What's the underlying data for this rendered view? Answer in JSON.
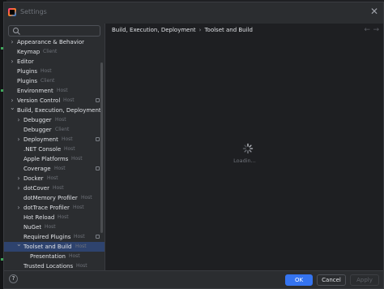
{
  "window": {
    "title": "Settings"
  },
  "search": {
    "placeholder": "",
    "value": ""
  },
  "tree": [
    {
      "label": "Appearance & Behavior",
      "hint": "",
      "chevron": "right",
      "level": 0,
      "selected": false,
      "project_icon": false
    },
    {
      "label": "Keymap",
      "hint": "Client",
      "chevron": "",
      "level": 0,
      "selected": false,
      "project_icon": false
    },
    {
      "label": "Editor",
      "hint": "",
      "chevron": "right",
      "level": 0,
      "selected": false,
      "project_icon": false
    },
    {
      "label": "Plugins",
      "hint": "Host",
      "chevron": "",
      "level": 0,
      "selected": false,
      "project_icon": false
    },
    {
      "label": "Plugins",
      "hint": "Client",
      "chevron": "",
      "level": 0,
      "selected": false,
      "project_icon": false
    },
    {
      "label": "Environment",
      "hint": "Host",
      "chevron": "",
      "level": 0,
      "selected": false,
      "project_icon": false
    },
    {
      "label": "Version Control",
      "hint": "Host",
      "chevron": "right",
      "level": 0,
      "selected": false,
      "project_icon": true
    },
    {
      "label": "Build, Execution, Deployment",
      "hint": "",
      "chevron": "down",
      "level": 0,
      "selected": false,
      "project_icon": false
    },
    {
      "label": "Debugger",
      "hint": "Host",
      "chevron": "right",
      "level": 1,
      "selected": false,
      "project_icon": false
    },
    {
      "label": "Debugger",
      "hint": "Client",
      "chevron": "",
      "level": 1,
      "selected": false,
      "project_icon": false
    },
    {
      "label": "Deployment",
      "hint": "Host",
      "chevron": "right",
      "level": 1,
      "selected": false,
      "project_icon": true
    },
    {
      "label": ".NET Console",
      "hint": "Host",
      "chevron": "",
      "level": 1,
      "selected": false,
      "project_icon": false
    },
    {
      "label": "Apple Platforms",
      "hint": "Host",
      "chevron": "",
      "level": 1,
      "selected": false,
      "project_icon": false
    },
    {
      "label": "Coverage",
      "hint": "Host",
      "chevron": "",
      "level": 1,
      "selected": false,
      "project_icon": true
    },
    {
      "label": "Docker",
      "hint": "Host",
      "chevron": "right",
      "level": 1,
      "selected": false,
      "project_icon": false
    },
    {
      "label": "dotCover",
      "hint": "Host",
      "chevron": "right",
      "level": 1,
      "selected": false,
      "project_icon": false
    },
    {
      "label": "dotMemory Profiler",
      "hint": "Host",
      "chevron": "",
      "level": 1,
      "selected": false,
      "project_icon": false
    },
    {
      "label": "dotTrace Profiler",
      "hint": "Host",
      "chevron": "right",
      "level": 1,
      "selected": false,
      "project_icon": false
    },
    {
      "label": "Hot Reload",
      "hint": "Host",
      "chevron": "",
      "level": 1,
      "selected": false,
      "project_icon": false
    },
    {
      "label": "NuGet",
      "hint": "Host",
      "chevron": "",
      "level": 1,
      "selected": false,
      "project_icon": false
    },
    {
      "label": "Required Plugins",
      "hint": "Host",
      "chevron": "",
      "level": 1,
      "selected": false,
      "project_icon": true
    },
    {
      "label": "Toolset and Build",
      "hint": "Host",
      "chevron": "down",
      "level": 1,
      "selected": true,
      "project_icon": false
    },
    {
      "label": "Presentation",
      "hint": "Host",
      "chevron": "",
      "level": 2,
      "selected": false,
      "project_icon": false
    },
    {
      "label": "Trusted Locations",
      "hint": "Host",
      "chevron": "",
      "level": 1,
      "selected": false,
      "project_icon": false
    }
  ],
  "content": {
    "breadcrumb": [
      "Build, Execution, Deployment",
      "Toolset and Build"
    ],
    "loading_text": "Loadin..."
  },
  "footer": {
    "help_label": "?",
    "ok_label": "OK",
    "cancel_label": "Cancel",
    "apply_label": "Apply"
  },
  "colors": {
    "accent": "#3574f0",
    "selection": "#2e436e",
    "background": "#2b2d30",
    "content_background": "#1e1f22"
  }
}
